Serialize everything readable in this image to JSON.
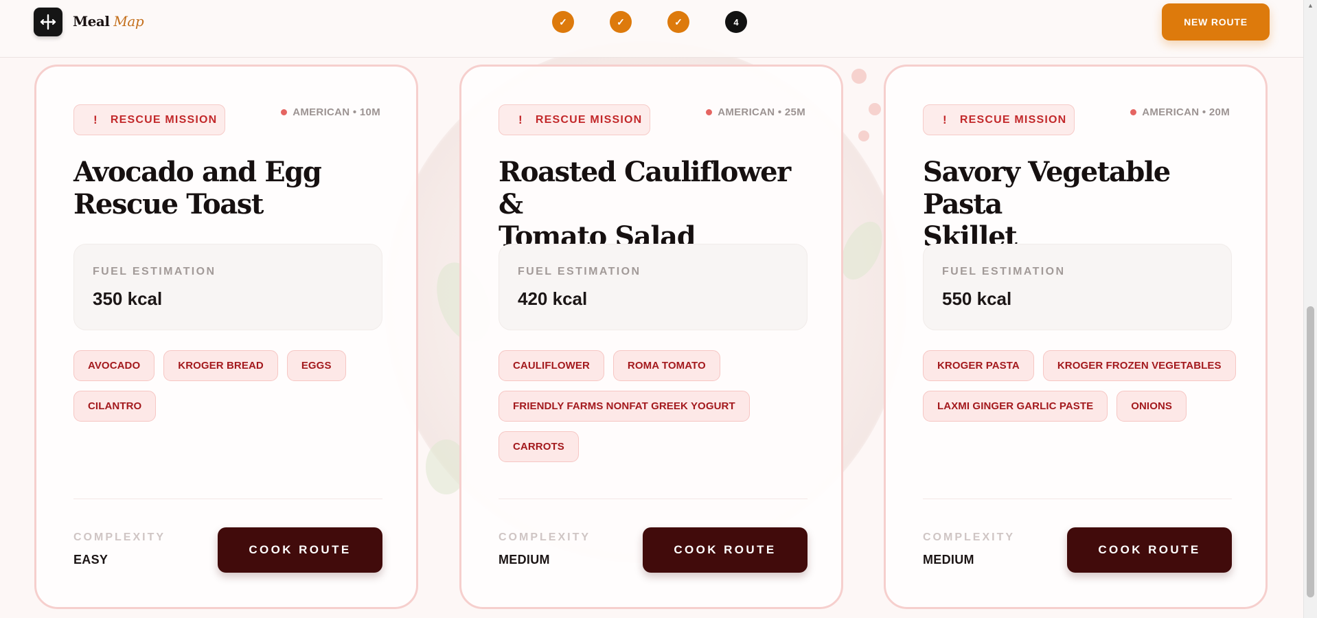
{
  "brand": {
    "name": "Meal",
    "accent": "Map"
  },
  "steps": [
    {
      "label": "✓",
      "state": "done"
    },
    {
      "label": "✓",
      "state": "done"
    },
    {
      "label": "✓",
      "state": "done"
    },
    {
      "label": "4",
      "state": "current"
    }
  ],
  "header": {
    "new_route_label": "NEW ROUTE"
  },
  "colors": {
    "accent": "#dd7a0c",
    "cta": "#410b0b",
    "mission": "#c2282a",
    "tag": "#a3191d"
  },
  "cards": [
    {
      "mission_label": "RESCUE MISSION",
      "mission_icon": "!",
      "meta": "AMERICAN • 10M",
      "title_line1": "Avocado and Egg",
      "title_line2": "Rescue Toast",
      "fuel_label": "FUEL ESTIMATION",
      "fuel_value": "350 kcal",
      "tags": [
        "AVOCADO",
        "KROGER BREAD",
        "EGGS",
        "CILANTRO"
      ],
      "complexity_label": "COMPLEXITY",
      "complexity_value": "EASY",
      "cook_label": "COOK ROUTE"
    },
    {
      "mission_label": "RESCUE MISSION",
      "mission_icon": "!",
      "meta": "AMERICAN • 25M",
      "title_line1": "Roasted Cauliflower &",
      "title_line2": "Tomato Salad",
      "fuel_label": "FUEL ESTIMATION",
      "fuel_value": "420 kcal",
      "tags": [
        "CAULIFLOWER",
        "ROMA TOMATO",
        "FRIENDLY FARMS NONFAT GREEK YOGURT",
        "CARROTS"
      ],
      "complexity_label": "COMPLEXITY",
      "complexity_value": "MEDIUM",
      "cook_label": "COOK ROUTE"
    },
    {
      "mission_label": "RESCUE MISSION",
      "mission_icon": "!",
      "meta": "AMERICAN • 20M",
      "title_line1": "Savory Vegetable Pasta",
      "title_line2": "Skillet",
      "fuel_label": "FUEL ESTIMATION",
      "fuel_value": "550 kcal",
      "tags": [
        "KROGER PASTA",
        "KROGER FROZEN VEGETABLES",
        "LAXMI GINGER GARLIC PASTE",
        "ONIONS"
      ],
      "complexity_label": "COMPLEXITY",
      "complexity_value": "MEDIUM",
      "cook_label": "COOK ROUTE"
    }
  ]
}
